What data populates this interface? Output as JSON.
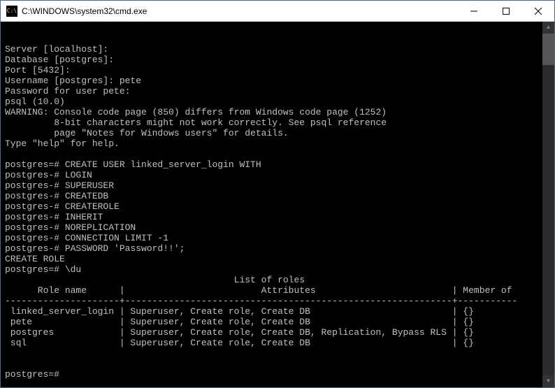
{
  "titlebar": {
    "icon_text": "C:\\",
    "title": "C:\\WINDOWS\\system32\\cmd.exe"
  },
  "terminal": {
    "lines": [
      "Server [localhost]:",
      "Database [postgres]:",
      "Port [5432]:",
      "Username [postgres]: pete",
      "Password for user pete:",
      "psql (10.0)",
      "WARNING: Console code page (850) differs from Windows code page (1252)",
      "         8-bit characters might not work correctly. See psql reference",
      "         page \"Notes for Windows users\" for details.",
      "Type \"help\" for help.",
      "",
      "postgres=# CREATE USER linked_server_login WITH",
      "postgres-# LOGIN",
      "postgres-# SUPERUSER",
      "postgres-# CREATEDB",
      "postgres-# CREATEROLE",
      "postgres-# INHERIT",
      "postgres-# NOREPLICATION",
      "postgres-# CONNECTION LIMIT -1",
      "postgres-# PASSWORD 'Password!!';",
      "CREATE ROLE",
      "postgres=# \\du",
      "                                          List of roles",
      "      Role name      |                         Attributes                         | Member of",
      "---------------------+------------------------------------------------------------+-----------",
      " linked_server_login | Superuser, Create role, Create DB                          | {}",
      " pete                | Superuser, Create role, Create DB                          | {}",
      " postgres            | Superuser, Create role, Create DB, Replication, Bypass RLS | {}",
      " sql                 | Superuser, Create role, Create DB                          | {}",
      "",
      "",
      "postgres=#"
    ]
  },
  "roles_table": {
    "title": "List of roles",
    "columns": [
      "Role name",
      "Attributes",
      "Member of"
    ],
    "rows": [
      {
        "role": "linked_server_login",
        "attributes": "Superuser, Create role, Create DB",
        "member_of": "{}"
      },
      {
        "role": "pete",
        "attributes": "Superuser, Create role, Create DB",
        "member_of": "{}"
      },
      {
        "role": "postgres",
        "attributes": "Superuser, Create role, Create DB, Replication, Bypass RLS",
        "member_of": "{}"
      },
      {
        "role": "sql",
        "attributes": "Superuser, Create role, Create DB",
        "member_of": "{}"
      }
    ]
  }
}
